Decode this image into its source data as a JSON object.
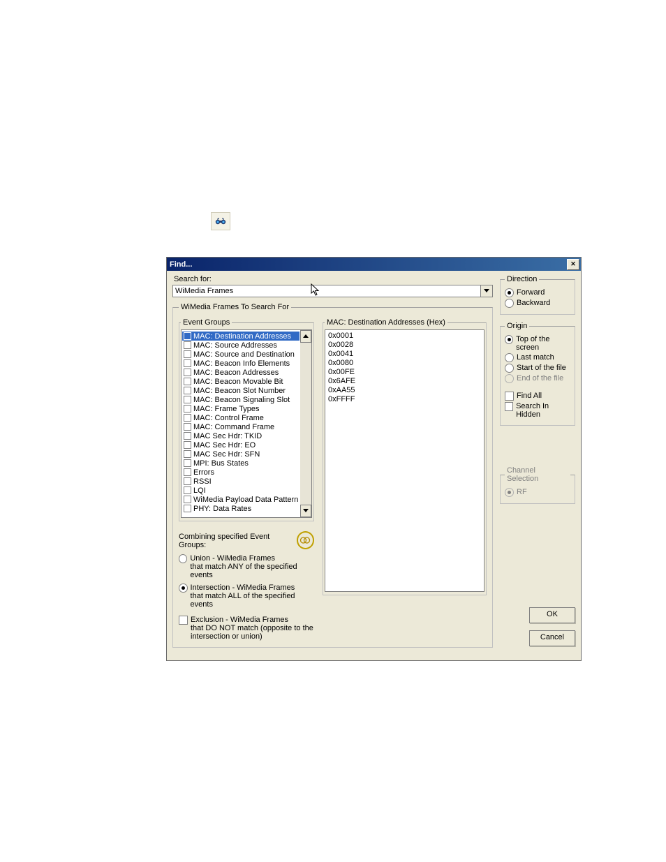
{
  "title": "Find...",
  "search_for_label": "Search for:",
  "search_for_value": "WiMedia Frames",
  "search_fieldset_legend": "WiMedia Frames To Search For",
  "event_groups_legend": "Event Groups",
  "event_groups": [
    {
      "label": "MAC: Destination Addresses",
      "selected": true
    },
    {
      "label": "MAC: Source Addresses"
    },
    {
      "label": "MAC: Source and Destination"
    },
    {
      "label": "MAC: Beacon Info Elements"
    },
    {
      "label": "MAC: Beacon Addresses"
    },
    {
      "label": "MAC: Beacon Movable Bit"
    },
    {
      "label": "MAC: Beacon Slot Number"
    },
    {
      "label": "MAC: Beacon Signaling Slot"
    },
    {
      "label": "MAC: Frame Types"
    },
    {
      "label": "MAC: Control Frame"
    },
    {
      "label": "MAC: Command Frame"
    },
    {
      "label": "MAC Sec Hdr: TKID"
    },
    {
      "label": "MAC Sec Hdr: EO"
    },
    {
      "label": "MAC Sec Hdr: SFN"
    },
    {
      "label": "MPI: Bus States"
    },
    {
      "label": "Errors"
    },
    {
      "label": "RSSI"
    },
    {
      "label": "LQI"
    },
    {
      "label": "WiMedia Payload Data Pattern"
    },
    {
      "label": "PHY: Data Rates"
    }
  ],
  "values_legend": "MAC: Destination Addresses (Hex)",
  "address_values": [
    "0x0001",
    "0x0028",
    "0x0041",
    "0x0080",
    "0x00FE",
    "0x6AFE",
    "0xAA55",
    "0xFFFF"
  ],
  "combine_label": "Combining specified Event Groups:",
  "combine_options": {
    "union": {
      "title": "Union - WiMedia Frames",
      "sub": "that match ANY of the specified events"
    },
    "intersection": {
      "title": "Intersection - WiMedia Frames",
      "sub": "that match ALL of the specified events",
      "selected": true
    },
    "exclusion": {
      "title": "Exclusion - WiMedia Frames",
      "sub": "that DO NOT match (opposite to the",
      "sub2": "intersection or union)"
    }
  },
  "direction": {
    "legend": "Direction",
    "forward": "Forward",
    "backward": "Backward",
    "selected": "forward"
  },
  "origin": {
    "legend": "Origin",
    "options": [
      {
        "label": "Top of the screen",
        "selected": true
      },
      {
        "label": "Last match"
      },
      {
        "label": "Start of the file"
      },
      {
        "label": "End of the file",
        "disabled": true
      }
    ]
  },
  "find_all_label": "Find All",
  "search_hidden_label": "Search In Hidden",
  "channel_legend": "Channel Selection",
  "channel_rf": "RF",
  "ok_label": "OK",
  "cancel_label": "Cancel"
}
